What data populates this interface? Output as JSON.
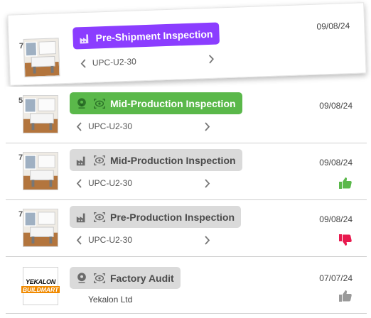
{
  "colors": {
    "purple": "#8b3dff",
    "green": "#5ab84a",
    "gray_pill": "#dadada",
    "thumb_up": "#5ab84a",
    "thumb_down": "#e8194e",
    "thumb_neutral": "#9a9a9a"
  },
  "inspections": [
    {
      "count": "7",
      "title": "Pre-Shipment Inspection",
      "date": "09/08/24",
      "code": "UPC-U2-30",
      "status_color": "purple",
      "icons": [
        "factory-icon"
      ]
    },
    {
      "count": "5",
      "title": "Mid-Production Inspection",
      "date": "09/08/24",
      "code": "UPC-U2-30",
      "status_color": "green",
      "icons": [
        "location-pin-icon",
        "eye-icon"
      ]
    },
    {
      "count": "7",
      "title": "Mid-Production Inspection",
      "date": "09/08/24",
      "code": "UPC-U2-30",
      "status_color": "gray",
      "icons": [
        "factory-icon",
        "eye-icon"
      ],
      "rating": "thumbs-up-icon"
    },
    {
      "count": "7",
      "title": "Pre-Production Inspection",
      "date": "09/08/24",
      "code": "UPC-U2-30",
      "status_color": "gray",
      "icons": [
        "factory-icon",
        "eye-icon"
      ],
      "rating": "thumbs-down-icon"
    },
    {
      "title": "Factory Audit",
      "date": "07/07/24",
      "vendor": "Yekalon Ltd",
      "status_color": "gray",
      "icons": [
        "location-pin-icon",
        "eye-icon"
      ],
      "rating": "thumbs-up-icon",
      "logo": {
        "line1": "YEKALON",
        "line2": "BUILDMART"
      }
    }
  ]
}
